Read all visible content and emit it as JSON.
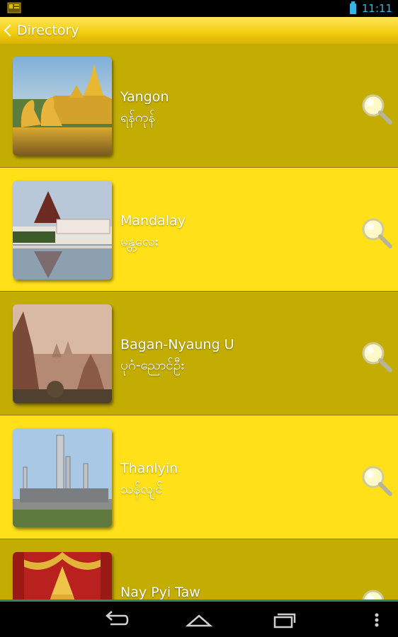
{
  "status_bar": {
    "time": "11:11",
    "accent": "#33b5e5"
  },
  "action_bar": {
    "title": "Directory",
    "back_icon": "chevron-left-icon"
  },
  "cities": [
    {
      "name_en": "Yangon",
      "name_my": "ရန်ကုန်",
      "image": "karaweik-palace",
      "shade": "dark"
    },
    {
      "name_en": "Mandalay",
      "name_my": "မန္တလေး",
      "image": "mandalay-palace",
      "shade": "light"
    },
    {
      "name_en": "Bagan-Nyaung U",
      "name_my": "ပုဂံ-ညောင်ဦး",
      "image": "bagan-temples",
      "shade": "dark"
    },
    {
      "name_en": "Thanlyin",
      "name_my": "သန်လျင်",
      "image": "refinery",
      "shade": "light"
    },
    {
      "name_en": "Nay Pyi Taw",
      "name_my": "",
      "image": "golden-throne",
      "shade": "dark"
    }
  ],
  "colors": {
    "row_dark": "#c4ad02",
    "row_light": "#ffe019",
    "action_bar": "#f4cf12"
  },
  "nav_bar": {
    "back": "back-icon",
    "home": "home-icon",
    "recents": "recents-icon",
    "menu": "overflow-menu-icon"
  }
}
